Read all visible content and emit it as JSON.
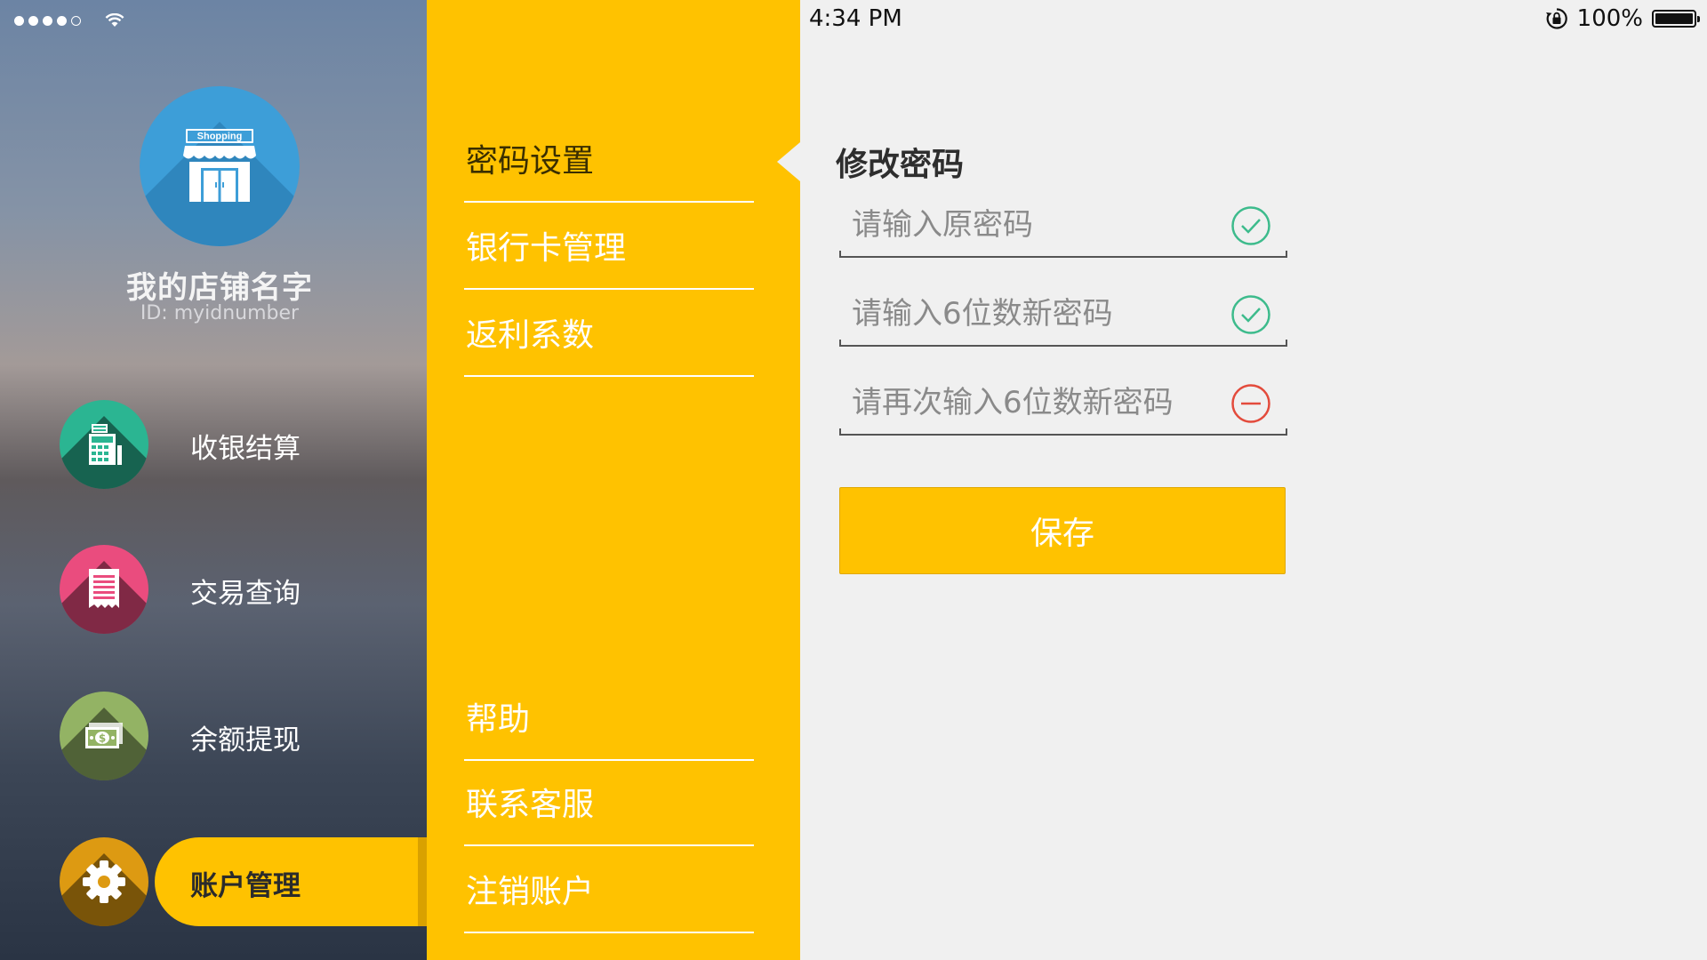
{
  "status_bar": {
    "time": "4:34 PM",
    "battery_text": "100%",
    "signal_bars_filled": 4,
    "signal_bars_total": 5
  },
  "sidebar": {
    "logo_text": "Shopping",
    "store_name": "我的店铺名字",
    "store_id": "ID: myidnumber",
    "items": [
      {
        "label": "收银结算",
        "icon": "cash-register-icon",
        "color": "#2bb592"
      },
      {
        "label": "交易查询",
        "icon": "receipt-icon",
        "color": "#ea4c7e"
      },
      {
        "label": "余额提现",
        "icon": "money-icon",
        "color": "#93b364"
      },
      {
        "label": "账户管理",
        "icon": "gear-icon",
        "color": "#dd9a12",
        "active": true
      }
    ]
  },
  "menu": {
    "top_items": [
      {
        "label": "密码设置",
        "selected": true
      },
      {
        "label": "银行卡管理"
      },
      {
        "label": "返利系数"
      }
    ],
    "bottom_items": [
      {
        "label": "帮助"
      },
      {
        "label": "联系客服"
      },
      {
        "label": "注销账户"
      }
    ]
  },
  "form": {
    "title": "修改密码",
    "fields": [
      {
        "placeholder": "请输入原密码",
        "value": "",
        "state": "valid"
      },
      {
        "placeholder": "请输入6位数新密码",
        "value": "",
        "state": "valid"
      },
      {
        "placeholder": "请再次输入6位数新密码",
        "value": "",
        "state": "invalid"
      }
    ],
    "save_label": "保存"
  },
  "colors": {
    "accent": "#ffc200",
    "valid": "#3dbb8c",
    "invalid": "#e34b3c"
  }
}
